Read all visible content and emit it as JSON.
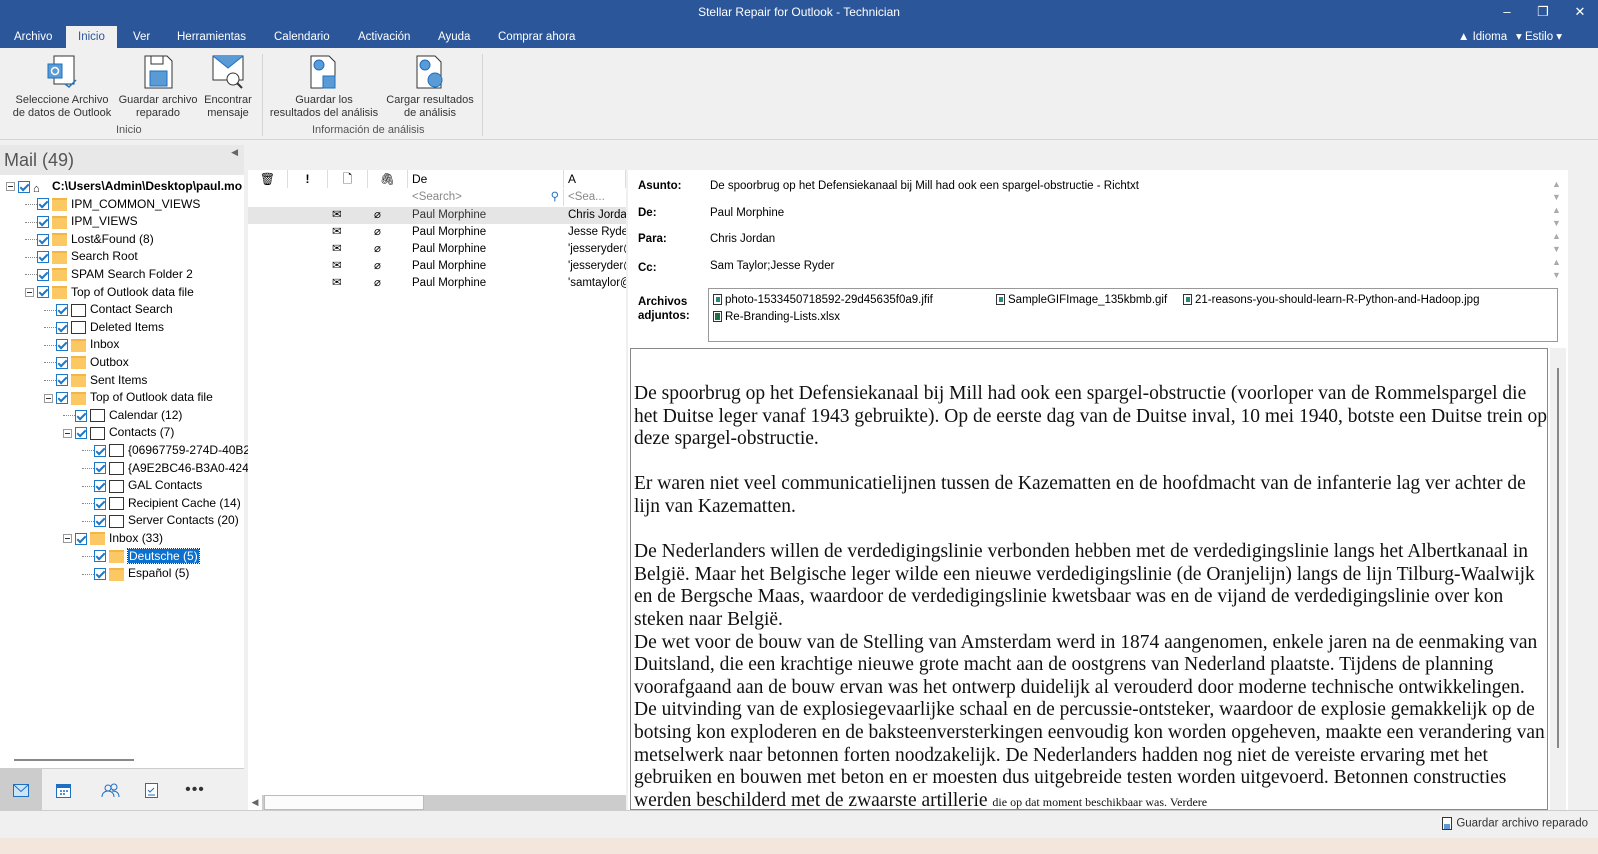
{
  "window": {
    "title": "Stellar Repair for Outlook - Technician"
  },
  "tabs": [
    "Archivo",
    "Inicio",
    "Ver",
    "Herramientas",
    "Calendario",
    "Activación",
    "Ayuda",
    "Comprar ahora"
  ],
  "tab_right": {
    "language": "Idioma",
    "style": "Estilo"
  },
  "ribbon": {
    "buttons": [
      {
        "label1": "Seleccione Archivo",
        "label2": "de datos de Outlook"
      },
      {
        "label1": "Guardar archivo",
        "label2": "reparado"
      },
      {
        "label1": "Encontrar",
        "label2": "mensaje"
      },
      {
        "label1": "Guardar los",
        "label2": "resultados del análisis"
      },
      {
        "label1": "Cargar resultados",
        "label2": "de análisis"
      }
    ],
    "groups": [
      "Inicio",
      "Información de análisis"
    ]
  },
  "left": {
    "title": "Mail (49)",
    "tree": [
      {
        "label": "C:\\Users\\Admin\\Desktop\\paul.mo",
        "icon": "pst-icon"
      },
      {
        "label": "IPM_COMMON_VIEWS",
        "icon": "folder"
      },
      {
        "label": "IPM_VIEWS",
        "icon": "folder"
      },
      {
        "label": "Lost&Found (8)",
        "icon": "folder"
      },
      {
        "label": "Search Root",
        "icon": "folder"
      },
      {
        "label": "SPAM Search Folder 2",
        "icon": "folder"
      },
      {
        "label": "Top of Outlook data file",
        "icon": "folder"
      },
      {
        "label": "Contact Search",
        "icon": "contact"
      },
      {
        "label": "Deleted Items",
        "icon": "trash"
      },
      {
        "label": "Inbox",
        "icon": "inbox"
      },
      {
        "label": "Outbox",
        "icon": "outbox"
      },
      {
        "label": "Sent Items",
        "icon": "sent"
      },
      {
        "label": "Top of Outlook data file",
        "icon": "folder"
      },
      {
        "label": "Calendar (12)",
        "icon": "calendar"
      },
      {
        "label": "Contacts (7)",
        "icon": "contact"
      },
      {
        "label": "{06967759-274D-40B2",
        "icon": "contact"
      },
      {
        "label": "{A9E2BC46-B3A0-424",
        "icon": "contact"
      },
      {
        "label": "GAL Contacts",
        "icon": "contact"
      },
      {
        "label": "Recipient Cache (14)",
        "icon": "contact"
      },
      {
        "label": "Server Contacts (20)",
        "icon": "contact"
      },
      {
        "label": "Inbox (33)",
        "icon": "inbox"
      },
      {
        "label": "Deutsche (5)",
        "icon": "folder"
      },
      {
        "label": "Español (5)",
        "icon": "folder"
      }
    ]
  },
  "list": {
    "columns": {
      "from": "De",
      "to": "A"
    },
    "search_placeholder": "<Search>",
    "search_placeholder_short": "<Sea...",
    "rows": [
      {
        "from": "Paul Morphine",
        "to": "Chris Jordan"
      },
      {
        "from": "Paul Morphine",
        "to": "Jesse Ryder"
      },
      {
        "from": "Paul Morphine",
        "to": "'jesseryder@"
      },
      {
        "from": "Paul Morphine",
        "to": "'jesseryder@"
      },
      {
        "from": "Paul Morphine",
        "to": "'samtaylor@"
      }
    ]
  },
  "preview": {
    "labels": {
      "subject": "Asunto:",
      "from": "De:",
      "to": "Para:",
      "cc": "Cc:",
      "attachments1": "Archivos",
      "attachments2": "adjuntos:"
    },
    "subject": "De spoorbrug op het Defensiekanaal bij Mill had ook een spargel-obstructie - Richtxt",
    "from": "Paul Morphine",
    "to": "Chris Jordan",
    "cc": "Sam Taylor;Jesse Ryder",
    "attachments": [
      "photo-1533450718592-29d45635f0a9.jfif",
      "SampleGIFImage_135kbmb.gif",
      "21-reasons-you-should-learn-R-Python-and-Hadoop.jpg",
      "Re-Branding-Lists.xlsx"
    ],
    "body": [
      "De spoorbrug op het Defensiekanaal bij Mill had ook een spargel-obstructie (voorloper van de Rommelspargel die het Duitse leger vanaf 1943 gebruikte). Op de eerste dag van de Duitse inval, 10 mei 1940, botste een Duitse trein op deze spargel-obstructie.",
      "Er waren niet veel communicatielijnen tussen de Kazematten en de hoofdmacht van de infanterie lag ver achter de lijn van Kazematten.",
      "De Nederlanders willen de verdedigingslinie verbonden hebben met de verdedigingslinie langs het Albertkanaal in België. Maar het Belgische leger wilde een nieuwe verdedigingslinie (de Oranjelijn) langs de lijn Tilburg-Waalwijk en de Bergsche Maas, waardoor de verdedigingslinie kwetsbaar was en de vijand de verdedigingslinie over kon steken naar België.",
      "De wet voor de bouw van de Stelling van Amsterdam werd in 1874 aangenomen, enkele jaren na de eenmaking van Duitsland, die een krachtige nieuwe grote macht aan de oostgrens van Nederland plaatste. Tijdens de planning voorafgaand aan de bouw ervan was het ontwerp duidelijk al verouderd door moderne technische ontwikkelingen. De uitvinding van de explosiegevaarlijke schaal en de percussie-ontsteker, waardoor de explosie gemakkelijk op de botsing kon exploderen en de baksteenversterkingen eenvoudig kon worden opgeheven, maakte een verandering van metselwerk naar betonnen forten noodzakelijk. De Nederlanders hadden nog niet de vereiste ervaring met het gebruiken en bouwen met beton en er moesten dus uitgebreide testen worden uitgevoerd. Betonnen constructies werden beschilderd met de zwaarste artillerie",
      "die op dat moment beschikbaar was. Verdere"
    ]
  },
  "status": {
    "save_label": "Guardar archivo reparado"
  }
}
